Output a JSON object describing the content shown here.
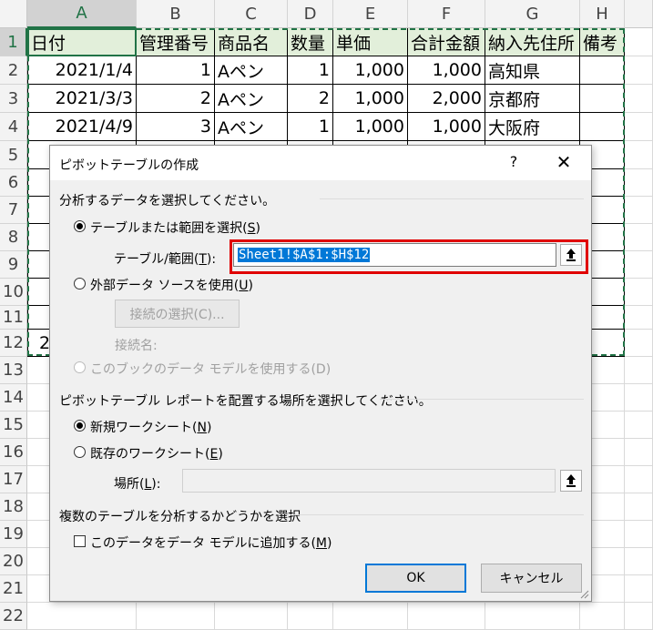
{
  "sheet": {
    "columns": [
      "A",
      "B",
      "C",
      "D",
      "E",
      "F",
      "G",
      "H"
    ],
    "rows": [
      "1",
      "2",
      "3",
      "4",
      "5",
      "6",
      "7",
      "8",
      "9",
      "10",
      "11",
      "12",
      "13",
      "14",
      "15",
      "16",
      "17",
      "18",
      "19",
      "20",
      "21",
      "22"
    ],
    "header": [
      "日付",
      "管理番号",
      "商品名",
      "数量",
      "単価",
      "合計金額",
      "納入先住所",
      "備考"
    ],
    "data": [
      [
        "2021/1/4",
        "1",
        "Aペン",
        "1",
        "1,000",
        "1,000",
        "高知県",
        ""
      ],
      [
        "2021/3/3",
        "2",
        "Aペン",
        "2",
        "1,000",
        "2,000",
        "京都府",
        ""
      ],
      [
        "2021/4/9",
        "3",
        "Aペン",
        "1",
        "1,000",
        "1,000",
        "大阪府",
        ""
      ]
    ],
    "partial_row12": "2"
  },
  "dialog": {
    "title": "ピボットテーブルの作成",
    "help": "?",
    "close": "✕",
    "section1": "分析するデータを選択してください。",
    "opt_table_range": "テーブルまたは範囲を選択(",
    "opt_table_range_key": "S",
    "opt_table_range_end": ")",
    "range_label": "テーブル/範囲(",
    "range_label_key": "T",
    "range_label_end": "):",
    "range_value": "Sheet1!$A$1:$H$12",
    "opt_external": "外部データ ソースを使用(",
    "opt_external_key": "U",
    "opt_external_end": ")",
    "choose_connection": "接続の選択(C)...",
    "connection_name": "接続名:",
    "opt_data_model": "このブックのデータ モデルを使用する(D)",
    "section2": "ピボットテーブル レポートを配置する場所を選択してください。",
    "opt_new_sheet": "新規ワークシート(",
    "opt_new_sheet_key": "N",
    "opt_new_sheet_end": ")",
    "opt_existing_sheet": "既存のワークシート(",
    "opt_existing_sheet_key": "E",
    "opt_existing_sheet_end": ")",
    "location_label": "場所(",
    "location_key": "L",
    "location_end": "):",
    "location_value": "",
    "section3": "複数のテーブルを分析するかどうかを選択",
    "add_to_model": "このデータをデータ モデルに追加する(",
    "add_to_model_key": "M",
    "add_to_model_end": ")",
    "ok": "OK",
    "cancel": "キャンセル"
  },
  "colors": {
    "excel_green": "#217346",
    "header_fill": "#e2efda",
    "highlight_red": "#e00000",
    "selection_blue": "#0078d7"
  }
}
